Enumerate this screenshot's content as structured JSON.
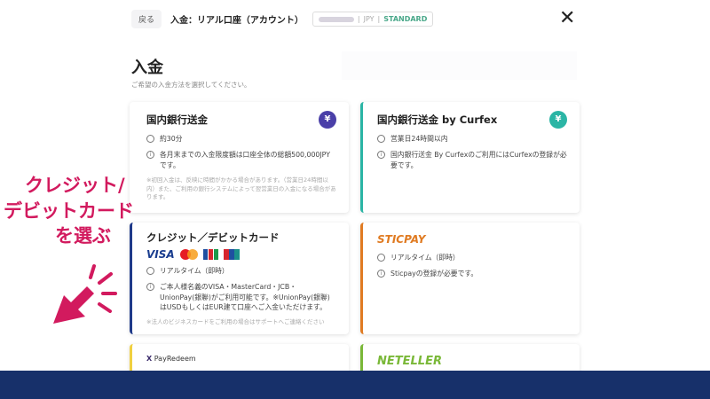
{
  "header": {
    "back": "戻る",
    "title": "入金：リアル口座（アカウント）",
    "currency": "JPY",
    "account_type": "STANDARD",
    "close_icon": "close-icon"
  },
  "page": {
    "title": "入金",
    "subtitle": "ご希望の入金方法を選択してください。"
  },
  "cards": [
    {
      "title": "国内銀行送金",
      "icon": "yen-icon",
      "accent": "#4a3fa8",
      "rows": [
        "約30分",
        "各月末までの入金限度額は口座全体の総額500,000JPYです。"
      ],
      "note": "※初回入金は、反映に時間がかかる場合があります。（営業日24時間以内）また、ご利用の銀行システムによって翌営業日の入金になる場合があります。"
    },
    {
      "title": "国内銀行送金 by Curfex",
      "icon": "yen-icon",
      "accent": "#2bb5a5",
      "rows": [
        "営業日24時間以内",
        "国内銀行送金 By Curfexのご利用にはCurfexの登録が必要です。"
      ]
    },
    {
      "title": "クレジット／デビットカード",
      "accent": "#1f3a8a",
      "brands": [
        "VISA",
        "MasterCard",
        "JCB",
        "UnionPay"
      ],
      "rows": [
        "リアルタイム（即時）",
        "ご本人様名義のVISA・MasterCard・JCB・UnionPay(銀聯)がご利用可能です。※UnionPay(銀聯)はUSDもしくはEUR建て口座へご入金いただけます。"
      ],
      "note": "※法人のビジネスカードをご利用の場合はサポートへご連絡ください"
    },
    {
      "title": "STICPAY",
      "accent": "#e07b22",
      "rows": [
        "リアルタイム（即時）",
        "Sticpayの登録が必要です。"
      ]
    },
    {
      "title": "PayRedeem",
      "accent": "#f0d040"
    },
    {
      "title": "NETELLER",
      "accent": "#7ab838"
    }
  ],
  "annotation": {
    "lines": [
      "クレジット/",
      "デビットカード",
      "を選ぶ"
    ],
    "color": "#d21a5e"
  }
}
